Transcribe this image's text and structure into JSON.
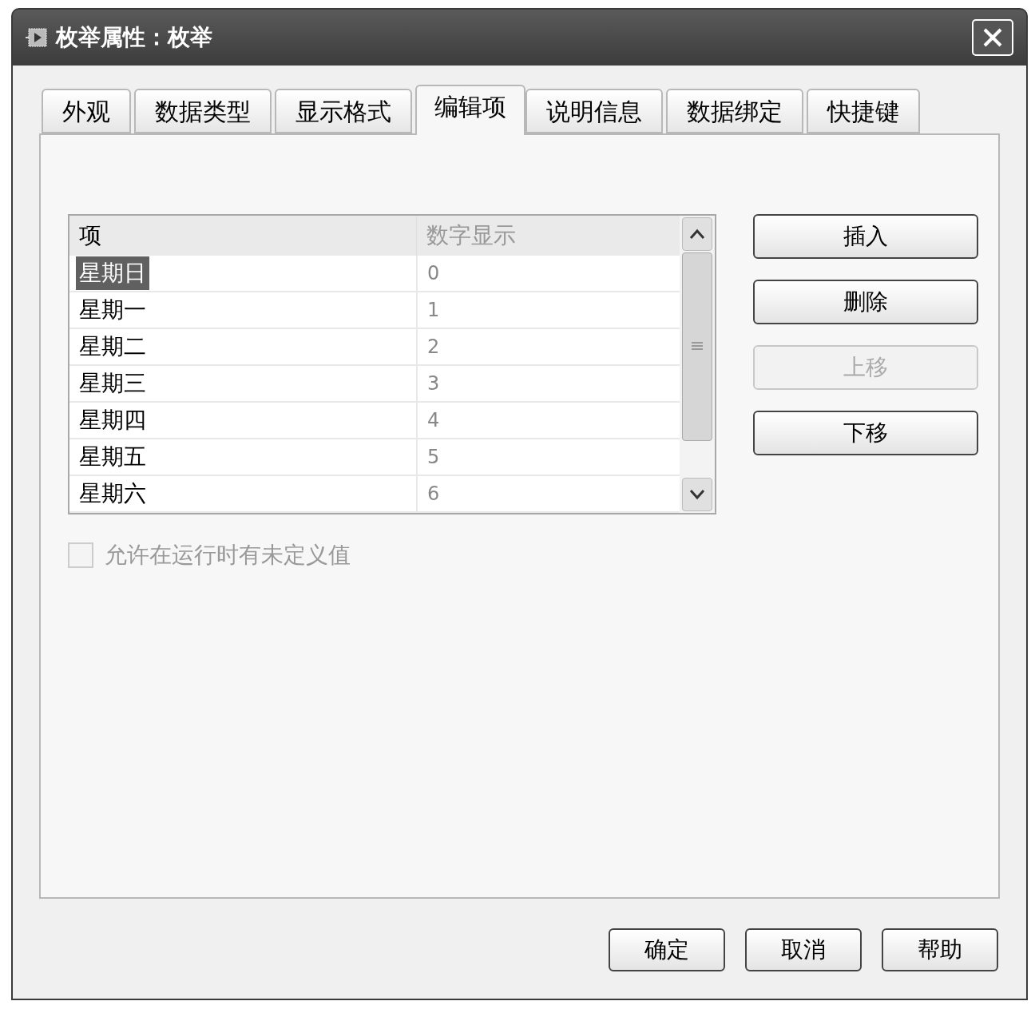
{
  "window": {
    "title": "枚举属性：枚举"
  },
  "tabs": [
    {
      "label": "外观",
      "selected": false
    },
    {
      "label": "数据类型",
      "selected": false
    },
    {
      "label": "显示格式",
      "selected": false
    },
    {
      "label": "编辑项",
      "selected": true
    },
    {
      "label": "说明信息",
      "selected": false
    },
    {
      "label": "数据绑定",
      "selected": false
    },
    {
      "label": "快捷键",
      "selected": false
    }
  ],
  "list": {
    "columns": [
      "项",
      "数字显示"
    ],
    "rows": [
      {
        "item": "星期日",
        "value": "0",
        "selected": true
      },
      {
        "item": "星期一",
        "value": "1",
        "selected": false
      },
      {
        "item": "星期二",
        "value": "2",
        "selected": false
      },
      {
        "item": "星期三",
        "value": "3",
        "selected": false
      },
      {
        "item": "星期四",
        "value": "4",
        "selected": false
      },
      {
        "item": "星期五",
        "value": "5",
        "selected": false
      },
      {
        "item": "星期六",
        "value": "6",
        "selected": false
      }
    ]
  },
  "side_buttons": [
    {
      "label": "插入",
      "disabled": false
    },
    {
      "label": "删除",
      "disabled": false
    },
    {
      "label": "上移",
      "disabled": true
    },
    {
      "label": "下移",
      "disabled": false
    }
  ],
  "checkbox": {
    "label": "允许在运行时有未定义值",
    "checked": false,
    "disabled": true
  },
  "buttons": [
    "确定",
    "取消",
    "帮助"
  ]
}
